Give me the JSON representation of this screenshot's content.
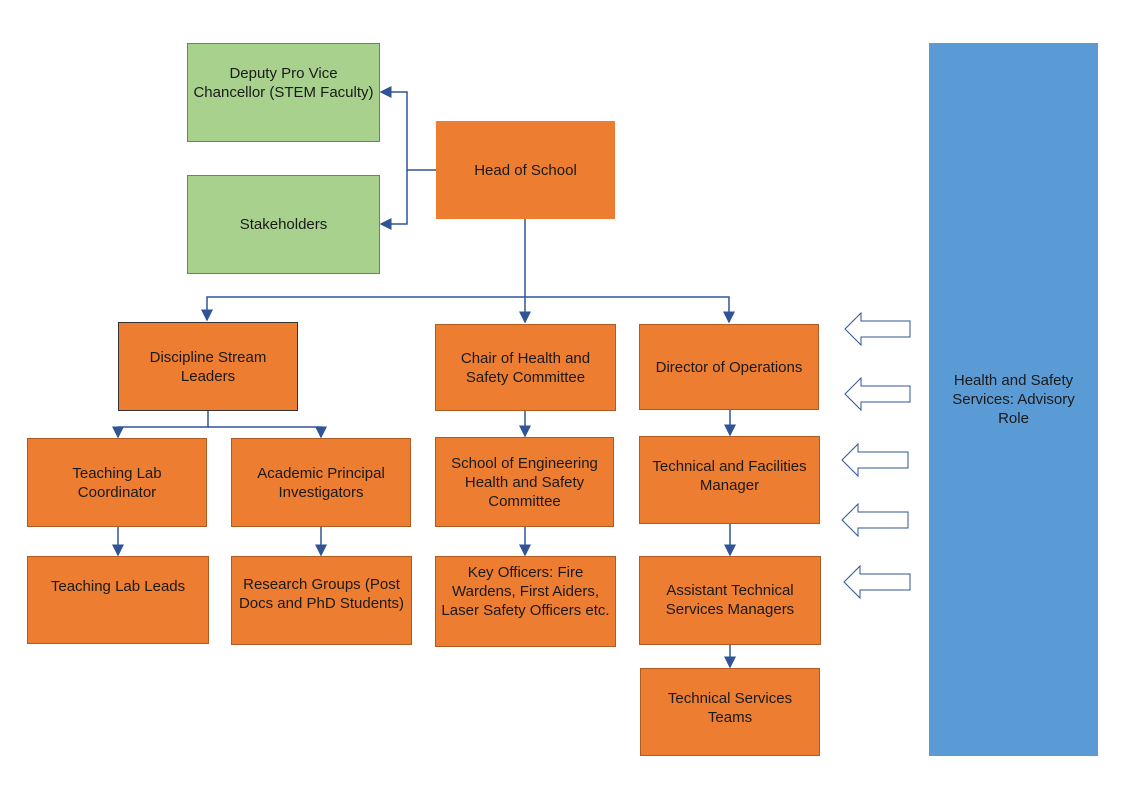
{
  "nodes": {
    "deputy": "Deputy Pro Vice Chancellor (STEM Faculty)",
    "stakeholders": "Stakeholders",
    "head": "Head of School",
    "discipline": "Discipline Stream Leaders",
    "chair": "Chair of Health and Safety Committee",
    "director": "Director of Operations",
    "teaching_coord": "Teaching Lab Coordinator",
    "academic_pi": "Academic Principal Investigators",
    "committee": "School of Engineering Health and Safety Committee",
    "tech_fac": "Technical and Facilities Manager",
    "teaching_leads": "Teaching Lab Leads",
    "research": "Research Groups (Post Docs and PhD Students)",
    "key_officers": "Key Officers: Fire Wardens, First Aiders, Laser Safety Officers etc.",
    "asst_tsm": "Assistant Technical Services Managers",
    "tech_teams": "Technical Services Teams",
    "hss": "Health and Safety Services: Advisory Role"
  },
  "colors": {
    "orange": "#ed7d31",
    "green": "#a9d18e",
    "blue": "#5b9bd5",
    "connector": "#2f5597"
  }
}
